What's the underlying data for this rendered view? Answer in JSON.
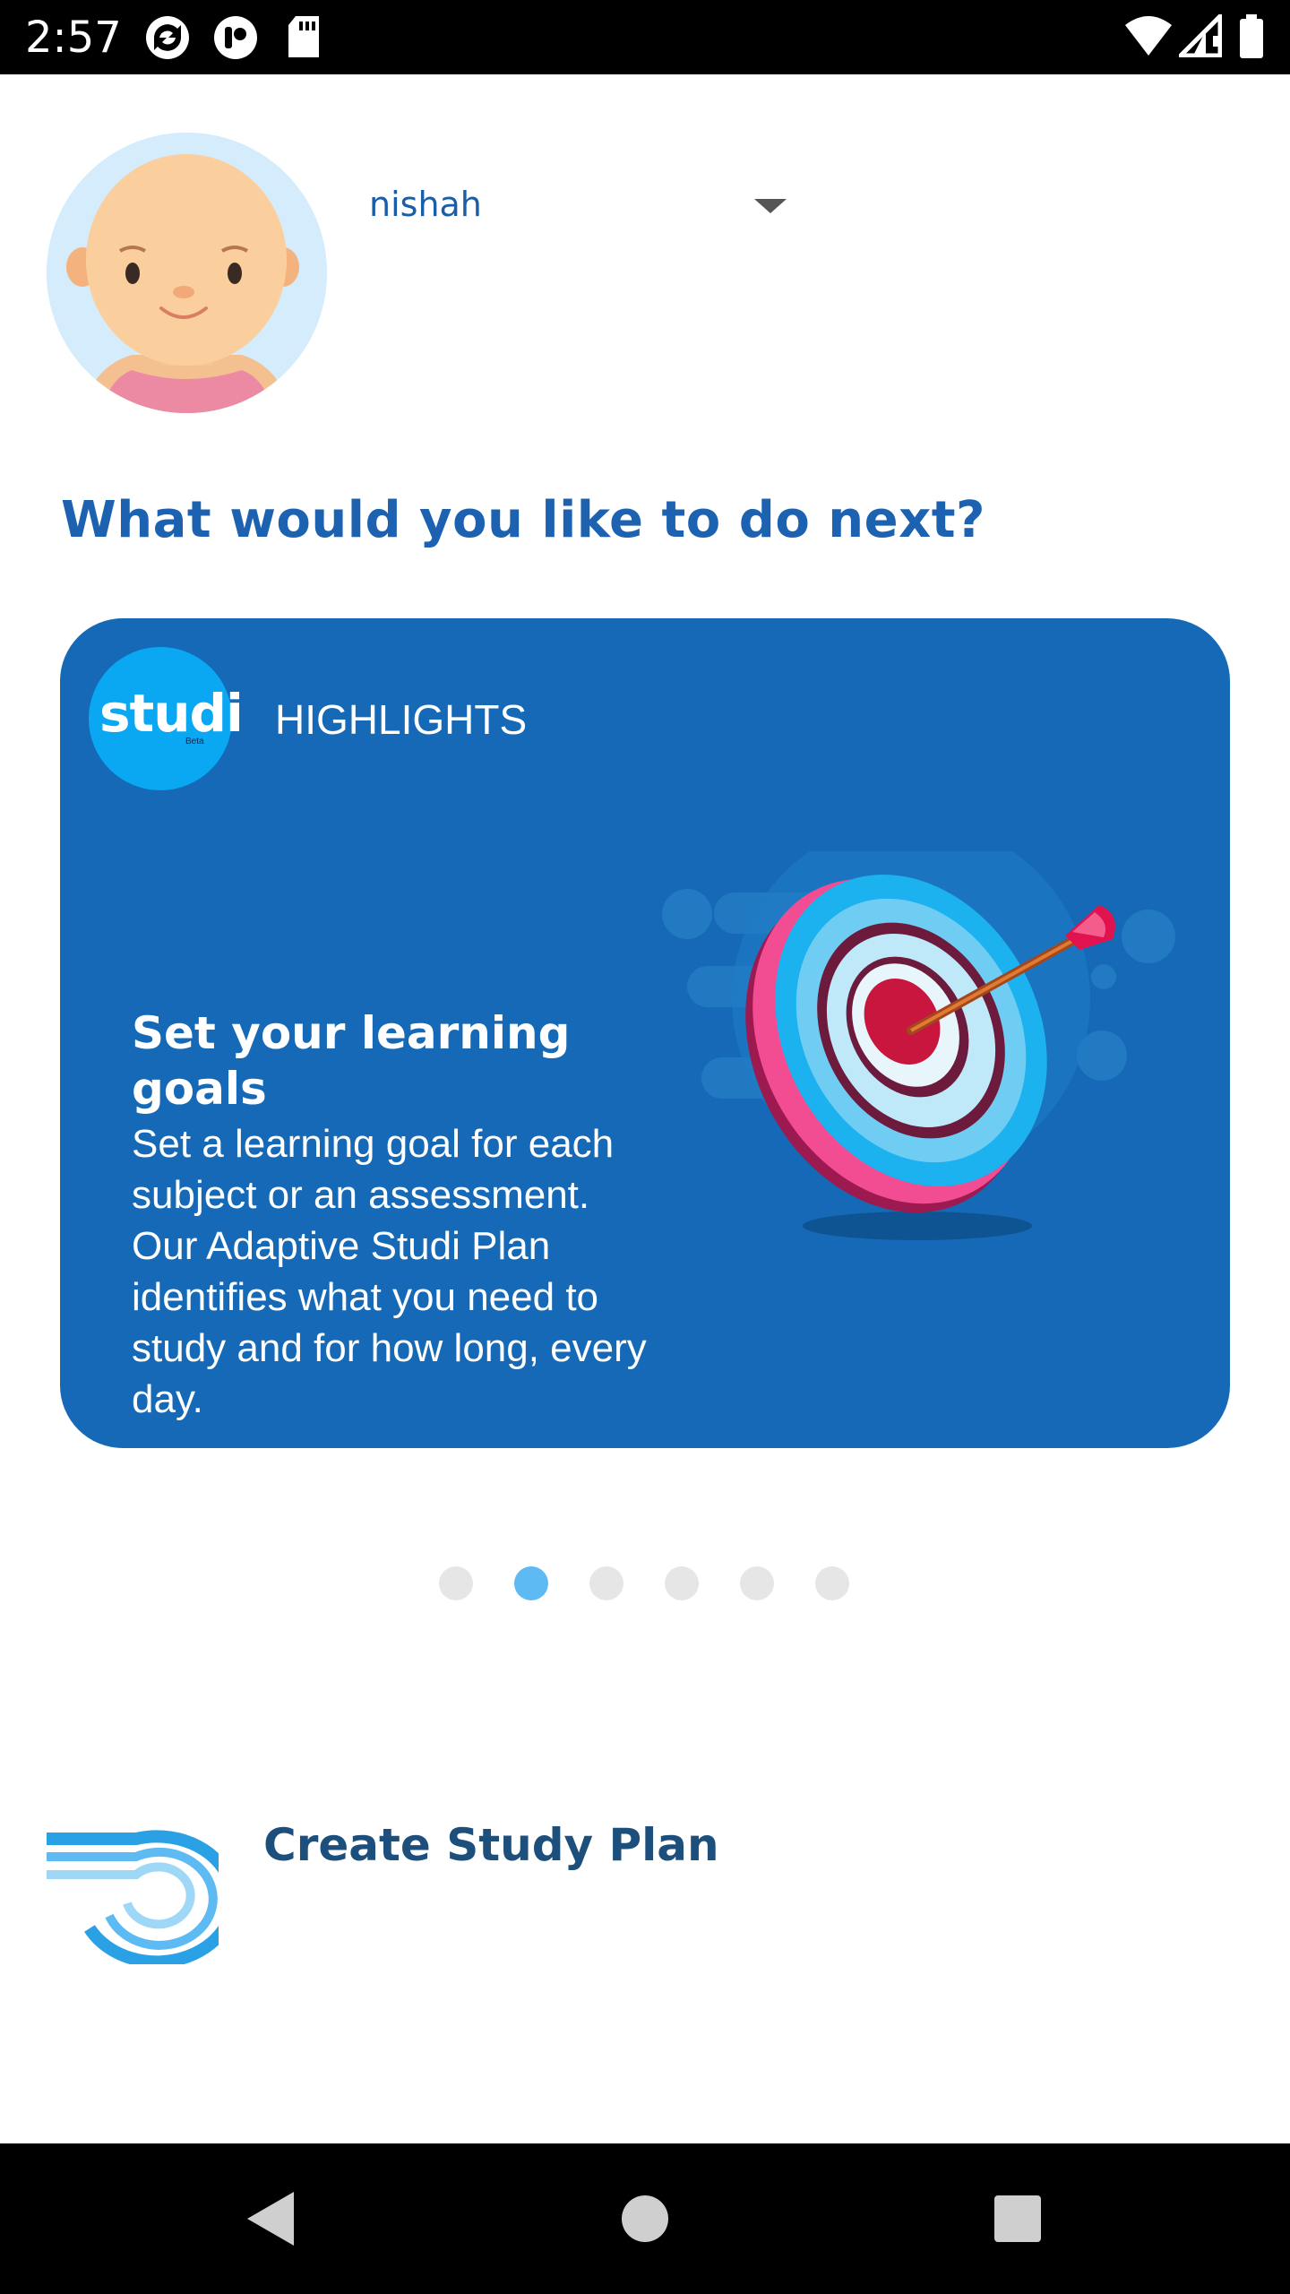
{
  "status_bar": {
    "time": "2:57",
    "icons": [
      "sync-icon",
      "notification-app-icon",
      "sd-card-icon",
      "wifi-icon",
      "signal-icon",
      "battery-icon"
    ]
  },
  "profile": {
    "avatar_icon": "child-avatar",
    "username": "nishah"
  },
  "question": "What would you like to do next?",
  "card": {
    "brand": "studi",
    "brand_sub": "Beta",
    "section": "HIGHLIGHTS",
    "title": "Set your learning goals",
    "body": "Set a learning goal for each subject or an assessment. Our Adaptive Studi Plan identifies what you need to study and for how long, every day.",
    "illustration": "dartboard-target-icon",
    "background_color": "#1569b6"
  },
  "pagination": {
    "total": 6,
    "active_index": 1,
    "active_color": "#5ebaf3",
    "inactive_color": "#e6e6e6"
  },
  "study_plan": {
    "label": "Create Study Plan",
    "icon": "study-plan-swirl-icon"
  },
  "navigation": {
    "buttons": [
      "back-icon",
      "home-icon",
      "recents-icon"
    ]
  }
}
